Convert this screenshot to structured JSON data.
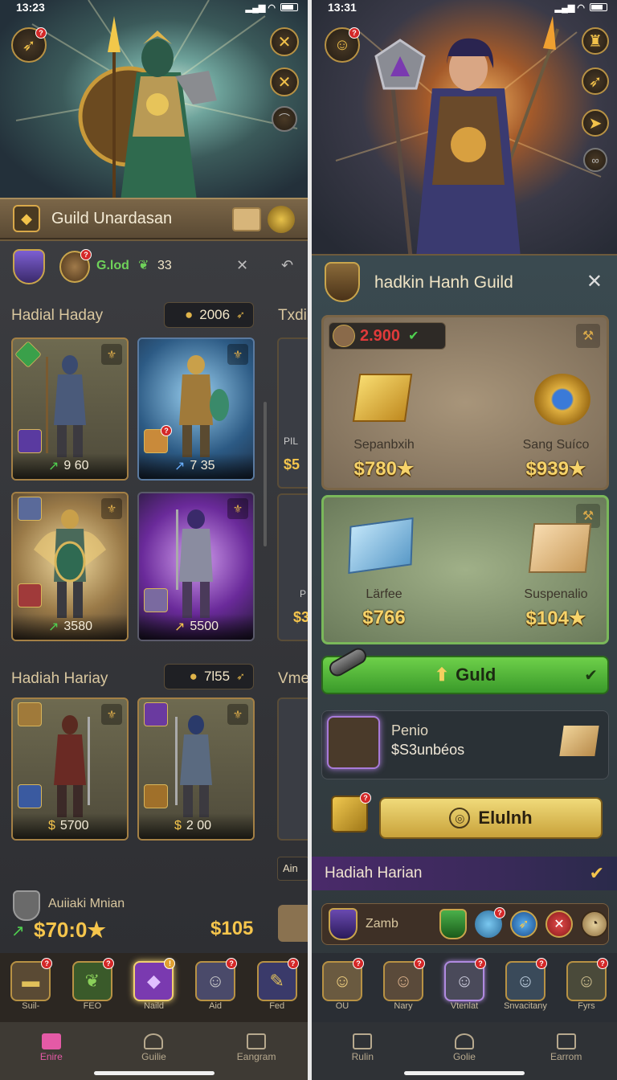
{
  "left": {
    "status_time": "13:23",
    "hero_bar_title": "Guild Unardasan",
    "resource_label": "G.lod",
    "resource_count": "33",
    "section1": {
      "title": "Hadial Haday",
      "currency": "2006"
    },
    "section2": {
      "title": "Hadiah Hariay",
      "currency": "7l55"
    },
    "cards": [
      {
        "value": "9 60",
        "theme": "olive"
      },
      {
        "value": "7 35",
        "theme": "blue"
      },
      {
        "value": "3580",
        "theme": "gold"
      },
      {
        "value": "5500",
        "theme": "purple"
      },
      {
        "value": "5700",
        "theme": "olive"
      },
      {
        "value": "2 00",
        "theme": "olive"
      }
    ],
    "peek_labels": [
      "Txdi",
      "PIL",
      "$5",
      "P",
      "$3",
      "Vme",
      "Ain"
    ],
    "reward_label": "Auiiaki Mnian",
    "reward_price": "$70:0★",
    "reward_right": "$105",
    "bottom_strip": [
      "Suil-",
      "FEO",
      "Naild",
      "Aid",
      "Fed"
    ],
    "tabs": [
      {
        "label": "Enire",
        "active": true
      },
      {
        "label": "Guilie",
        "active": false
      },
      {
        "label": "Eangram",
        "active": false
      }
    ]
  },
  "right": {
    "status_time": "13:31",
    "guild_title": "hadkin Hanh Guild",
    "balance": "2.900",
    "shop_items": [
      {
        "name": "Sepanbxih",
        "price": "$780★"
      },
      {
        "name": "Sang Suíco",
        "price": "$939★"
      },
      {
        "name": "Lärfee",
        "price": "$766"
      },
      {
        "name": "Suspenalio",
        "price": "$104★"
      }
    ],
    "guild_button": "Guld",
    "promo": {
      "title": "Penio",
      "subtitle": "$S3unbéos"
    },
    "action_button": "Elulnh",
    "daily_banner": "Hadiah Harian",
    "zamb_label": "Zamb",
    "bottom_strip": [
      "OU",
      "Nary",
      "Vtenlat",
      "Snvacitany",
      "Fyrs"
    ],
    "tabs": [
      {
        "label": "Rulin",
        "active": false
      },
      {
        "label": "Golie",
        "active": false
      },
      {
        "label": "Earrom",
        "active": false
      }
    ]
  },
  "colors": {
    "accent_gold": "#f5c54c",
    "active_tab": "#e45aa6",
    "green_button": "#4fa83a",
    "notify_red": "#d42828"
  }
}
